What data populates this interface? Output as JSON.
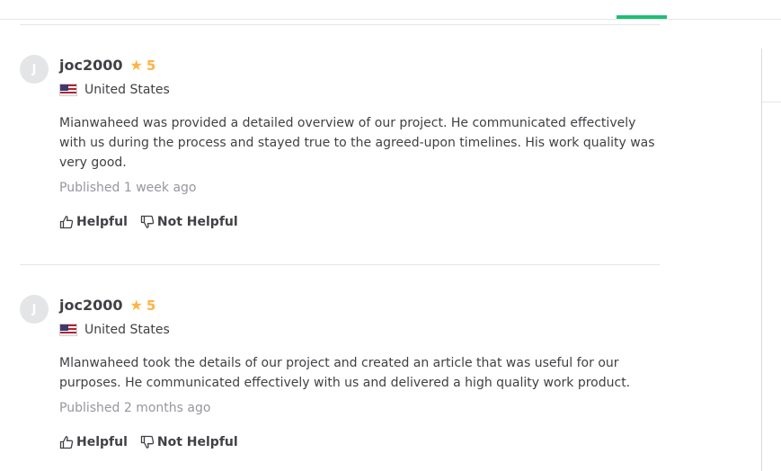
{
  "ui": {
    "colors": {
      "accent": "#1dbf73",
      "star": "#ffb33e",
      "text": "#404145",
      "muted": "#95979d"
    }
  },
  "reviews": [
    {
      "avatar_letter": "J",
      "username": "joc2000",
      "rating": "5",
      "country": "United States",
      "text": "Mianwaheed was provided a detailed overview of our project. He communicated effectively with us during the process and stayed true to the agreed-upon timelines. His work quality was very good.",
      "published": "Published 1 week ago",
      "helpful_label": "Helpful",
      "not_helpful_label": "Not Helpful"
    },
    {
      "avatar_letter": "J",
      "username": "joc2000",
      "rating": "5",
      "country": "United States",
      "text": "Mlanwaheed took the details of our project and created an article that was useful for our purposes. He communicated effectively with us and delivered a high quality work product.",
      "published": "Published 2 months ago",
      "helpful_label": "Helpful",
      "not_helpful_label": "Not Helpful"
    }
  ]
}
